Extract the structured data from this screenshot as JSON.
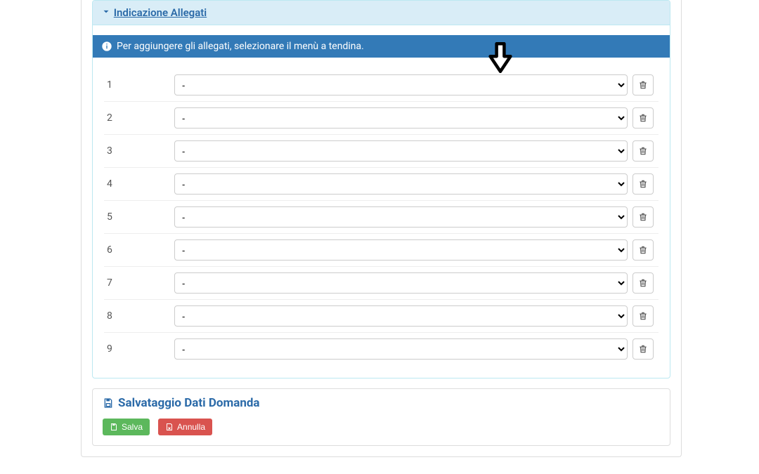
{
  "panels": {
    "attachments": {
      "title": "Indicazione Allegati",
      "info": "Per aggiungere gli allegati, selezionare il menù a tendina.",
      "default_option": "-",
      "rows": [
        {
          "n": "1"
        },
        {
          "n": "2"
        },
        {
          "n": "3"
        },
        {
          "n": "4"
        },
        {
          "n": "5"
        },
        {
          "n": "6"
        },
        {
          "n": "7"
        },
        {
          "n": "8"
        },
        {
          "n": "9"
        }
      ]
    },
    "save": {
      "title": "Salvataggio Dati Domanda",
      "save_label": "Salva",
      "cancel_label": "Annulla"
    }
  }
}
